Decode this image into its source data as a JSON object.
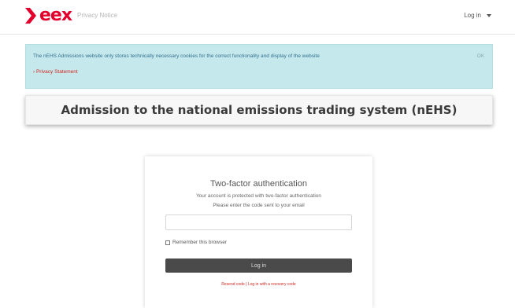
{
  "navbar": {
    "logo_text": "eex",
    "privacy_link": "Privacy Notice",
    "login_label": "Log in"
  },
  "cookie_banner": {
    "text": "The nEHS Admissions website only stores technically necessary cookies for the correct functionality and display of the website",
    "privacy_link": "› Privacy Statement",
    "ok_label": "OK"
  },
  "page_title": "Admission to the national emissions trading system (nEHS)",
  "twofactor": {
    "title": "Two-factor authentication",
    "line1": "Your account is protected with two-factor authentication",
    "line2": "Please enter the code sent to your email",
    "code_value": "",
    "remember_label": "Remember this browser",
    "remember_checked": false,
    "login_button": "Log in",
    "resend_link": "Resend code",
    "separator": " | ",
    "recovery_link": "Log in with a recovery code"
  },
  "colors": {
    "brand": "#e3002d",
    "banner_bg": "#c5e8ec",
    "button_bg": "#4a4a4a",
    "link": "#d2281f"
  }
}
